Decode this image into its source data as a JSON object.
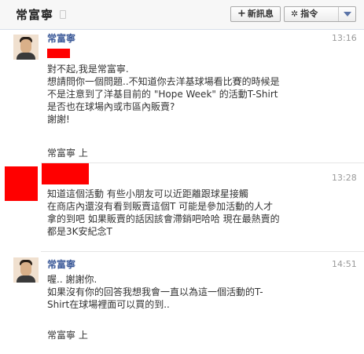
{
  "header": {
    "title": "常富寧",
    "new_message_label": "新訊息",
    "actions_label": "指令"
  },
  "messages": [
    {
      "sender": "常富寧",
      "time": "13:16",
      "lines": [
        "對不起,我是常富寧.",
        "想請問你一個問題..不知道你去洋基球場看比賽的時候是",
        "不是注意到了洋基目前的 \"Hope Week\" 的活動T-Shirt",
        "是否也在球場內或市區內販賣?",
        "謝謝!"
      ],
      "signature": "常富寧  上"
    },
    {
      "sender": "",
      "time": "13:28",
      "lines": [
        "知道這個活動 有些小朋友可以近距離跟球星接觸",
        "在商店內還沒有看到販賣這個T 可能是參加活動的人才",
        "拿的到吧 如果販賣的話因該會滯銷吧哈哈 現在最熱賣的",
        "都是3K安紀念T"
      ]
    },
    {
      "sender": "常富寧",
      "time": "14:51",
      "lines": [
        "喔.. 謝謝你.",
        "如果沒有你的回答我想我會一直以為這一個活動的T-",
        "Shirt在球場裡面可以買的到.."
      ],
      "signature": "常富寧  上"
    }
  ]
}
